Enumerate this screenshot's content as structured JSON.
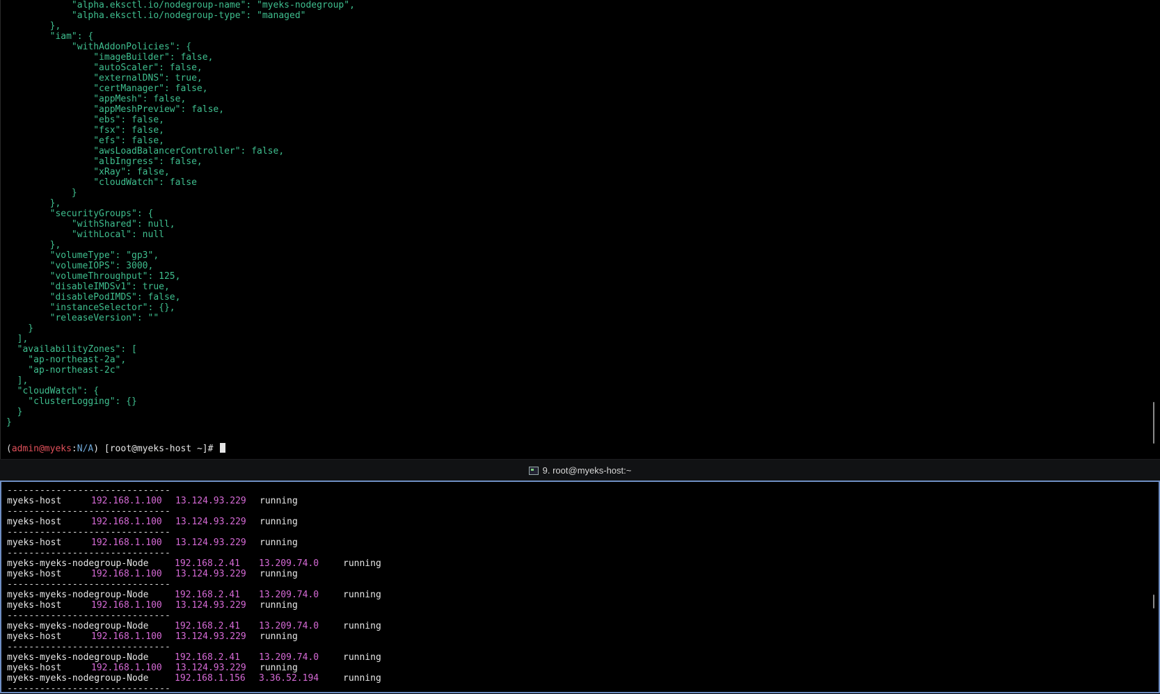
{
  "top_pane": {
    "json_lines": [
      "            \"alpha.eksctl.io/nodegroup-name\": \"myeks-nodegroup\",",
      "            \"alpha.eksctl.io/nodegroup-type\": \"managed\"",
      "        },",
      "        \"iam\": {",
      "            \"withAddonPolicies\": {",
      "                \"imageBuilder\": false,",
      "                \"autoScaler\": false,",
      "                \"externalDNS\": true,",
      "                \"certManager\": false,",
      "                \"appMesh\": false,",
      "                \"appMeshPreview\": false,",
      "                \"ebs\": false,",
      "                \"fsx\": false,",
      "                \"efs\": false,",
      "                \"awsLoadBalancerController\": false,",
      "                \"albIngress\": false,",
      "                \"xRay\": false,",
      "                \"cloudWatch\": false",
      "            }",
      "        },",
      "        \"securityGroups\": {",
      "            \"withShared\": null,",
      "            \"withLocal\": null",
      "        },",
      "        \"volumeType\": \"gp3\",",
      "        \"volumeIOPS\": 3000,",
      "        \"volumeThroughput\": 125,",
      "        \"disableIMDSv1\": true,",
      "        \"disablePodIMDS\": false,",
      "        \"instanceSelector\": {},",
      "        \"releaseVersion\": \"\"",
      "    }",
      "  ],",
      "  \"availabilityZones\": [",
      "    \"ap-northeast-2a\",",
      "    \"ap-northeast-2c\"",
      "  ],",
      "  \"cloudWatch\": {",
      "    \"clusterLogging\": {}",
      "  }",
      "}"
    ],
    "prompt": {
      "open_paren": "(",
      "user": "admin@myeks",
      "colon": ":",
      "context": "N/A",
      "rest": ") [root@myeks-host ~]# "
    }
  },
  "tabbar": {
    "title": "9. root@myeks-host:~",
    "icon": "terminal-icon"
  },
  "bottom_pane": {
    "dash": "------------------------------",
    "blocks": [
      [
        {
          "name": "myeks-host",
          "private_ip": "192.168.1.100",
          "public_ip": "13.124.93.229",
          "state": "running"
        }
      ],
      [
        {
          "name": "myeks-host",
          "private_ip": "192.168.1.100",
          "public_ip": "13.124.93.229",
          "state": "running"
        }
      ],
      [
        {
          "name": "myeks-host",
          "private_ip": "192.168.1.100",
          "public_ip": "13.124.93.229",
          "state": "running"
        }
      ],
      [
        {
          "name": "myeks-myeks-nodegroup-Node",
          "private_ip": "192.168.2.41",
          "public_ip": "13.209.74.0",
          "state": "running"
        },
        {
          "name": "myeks-host",
          "private_ip": "192.168.1.100",
          "public_ip": "13.124.93.229",
          "state": "running"
        }
      ],
      [
        {
          "name": "myeks-myeks-nodegroup-Node",
          "private_ip": "192.168.2.41",
          "public_ip": "13.209.74.0",
          "state": "running"
        },
        {
          "name": "myeks-host",
          "private_ip": "192.168.1.100",
          "public_ip": "13.124.93.229",
          "state": "running"
        }
      ],
      [
        {
          "name": "myeks-myeks-nodegroup-Node",
          "private_ip": "192.168.2.41",
          "public_ip": "13.209.74.0",
          "state": "running"
        },
        {
          "name": "myeks-host",
          "private_ip": "192.168.1.100",
          "public_ip": "13.124.93.229",
          "state": "running"
        }
      ],
      [
        {
          "name": "myeks-myeks-nodegroup-Node",
          "private_ip": "192.168.2.41",
          "public_ip": "13.209.74.0",
          "state": "running"
        },
        {
          "name": "myeks-host",
          "private_ip": "192.168.1.100",
          "public_ip": "13.124.93.229",
          "state": "running"
        },
        {
          "name": "myeks-myeks-nodegroup-Node",
          "private_ip": "192.168.1.156",
          "public_ip": "3.36.52.194",
          "state": "running"
        }
      ]
    ],
    "trailing_dash": true
  },
  "colors": {
    "json_text": "#3fbf8f",
    "prompt_user": "#e0505a",
    "prompt_context": "#6fa8d8",
    "ip_text": "#d66ad6",
    "active_pane_border": "#6f8fc4"
  }
}
